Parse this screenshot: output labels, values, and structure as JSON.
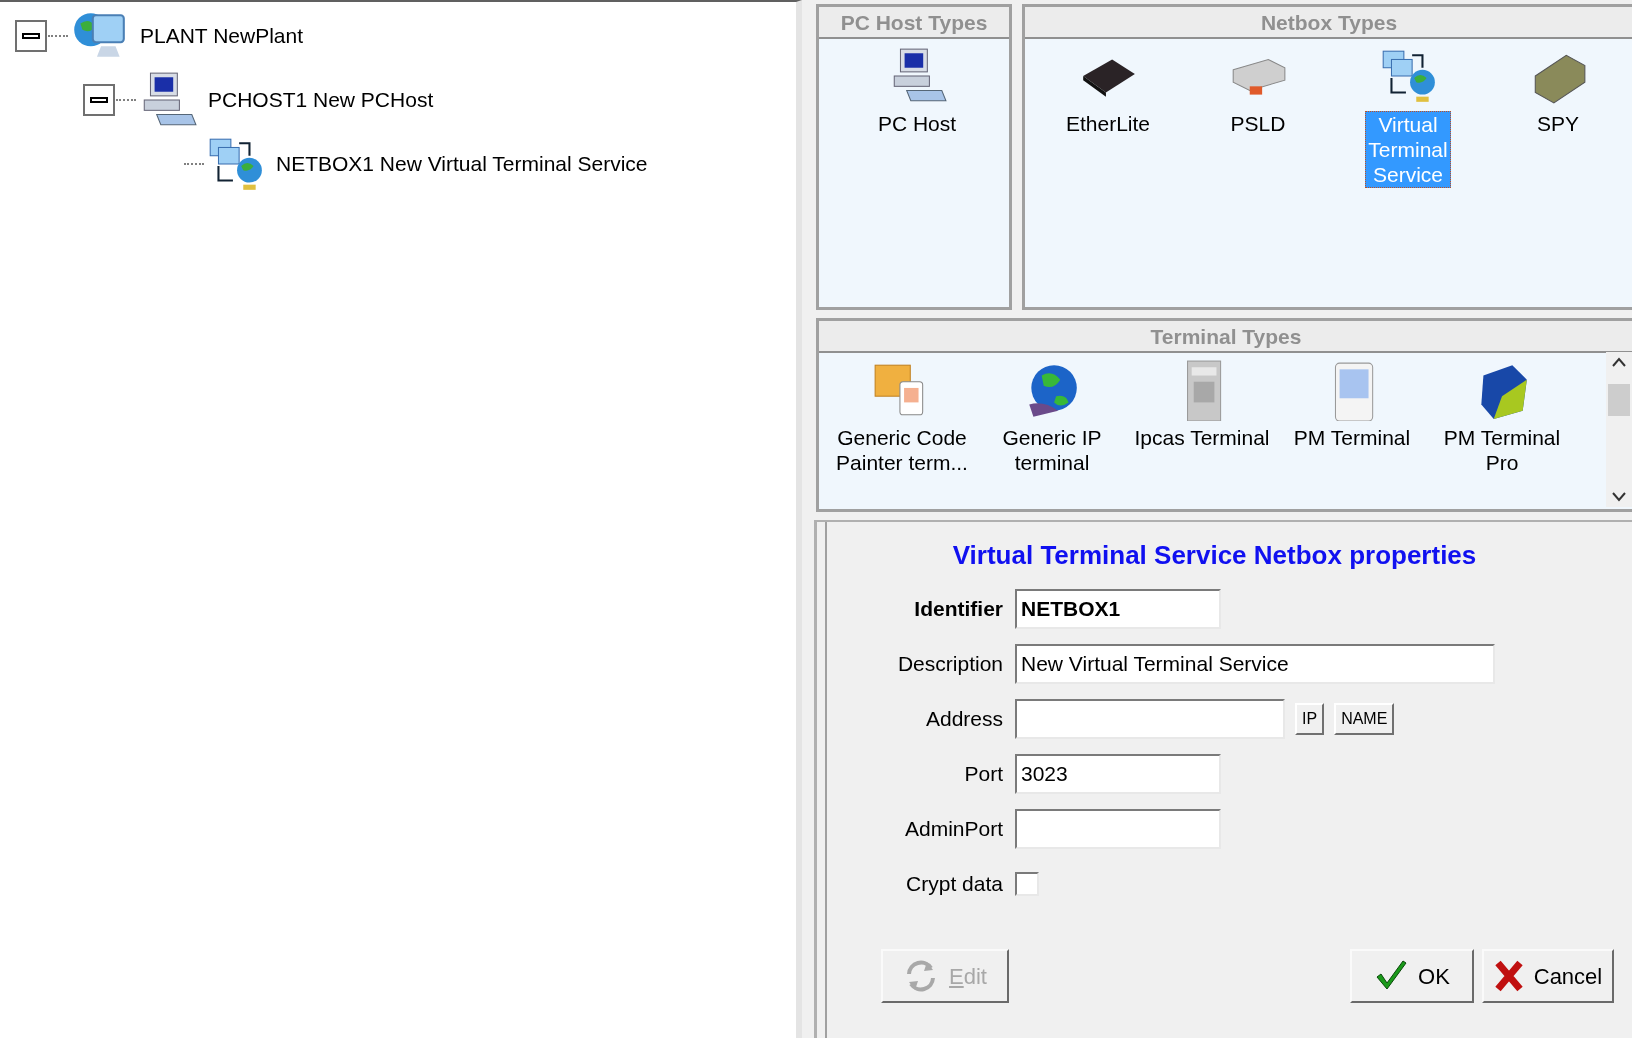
{
  "tree": [
    {
      "label": "PLANT NewPlant",
      "kind": "plant",
      "expanded": true,
      "children": [
        {
          "label": "PCHOST1 New PCHost",
          "kind": "pchost",
          "expanded": true,
          "children": [
            {
              "label": "NETBOX1 New Virtual Terminal Service",
              "kind": "netbox"
            }
          ]
        }
      ]
    }
  ],
  "pc_host_types": {
    "title": "PC Host Types",
    "items": [
      {
        "label": "PC Host",
        "kind": "pchost",
        "selected": false
      }
    ]
  },
  "netbox_types": {
    "title": "Netbox Types",
    "items": [
      {
        "label": "EtherLite",
        "kind": "etherlite",
        "selected": false
      },
      {
        "label": "PSLD",
        "kind": "psld",
        "selected": false
      },
      {
        "label": "Virtual Terminal Service",
        "kind": "netbox",
        "selected": true
      },
      {
        "label": "SPY",
        "kind": "spy",
        "selected": false
      }
    ]
  },
  "terminal_types": {
    "title": "Terminal Types",
    "items": [
      {
        "label": "Generic Code Painter term...",
        "kind": "painter",
        "selected": false
      },
      {
        "label": "Generic IP terminal",
        "kind": "globe",
        "selected": false
      },
      {
        "label": "Ipcas Terminal",
        "kind": "ipcas",
        "selected": false
      },
      {
        "label": "PM Terminal",
        "kind": "pm",
        "selected": false
      },
      {
        "label": "PM Terminal Pro",
        "kind": "pmpro",
        "selected": false
      }
    ]
  },
  "properties": {
    "title": "Virtual Terminal Service Netbox properties",
    "fields": [
      {
        "label": "Identifier",
        "kind": "text",
        "value": "NETBOX1",
        "bold": true
      },
      {
        "label": "Description",
        "kind": "longtext",
        "value": "New Virtual Terminal Service",
        "bold": false
      },
      {
        "label": "Address",
        "kind": "address",
        "buttons": [
          "IP",
          "NAME"
        ],
        "bold": false
      },
      {
        "label": "Port",
        "kind": "text",
        "value": "3023",
        "bold": false
      },
      {
        "label": "AdminPort",
        "kind": "text",
        "bold": false
      },
      {
        "label": "Crypt data",
        "kind": "checkbox",
        "checked": false,
        "bold": false
      }
    ],
    "buttons": [
      {
        "label": "Edit",
        "kind": "edit",
        "disabled": true
      },
      {
        "label": "OK",
        "kind": "ok",
        "disabled": false
      },
      {
        "label": "Cancel",
        "kind": "cancel",
        "disabled": false
      }
    ]
  }
}
